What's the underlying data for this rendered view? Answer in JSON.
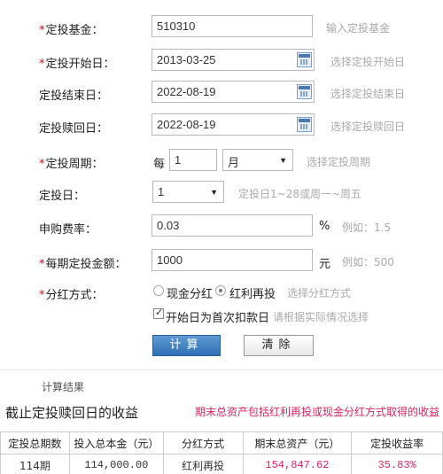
{
  "form": {
    "fund": {
      "label": "定投基金：",
      "required": true,
      "value": "510310",
      "hint": "输入定投基金"
    },
    "start": {
      "label": "定投开始日：",
      "required": true,
      "value": "2013-03-25",
      "hint": "选择定投开始日"
    },
    "end": {
      "label": "定投结束日：",
      "required": false,
      "value": "2022-08-19",
      "hint": "选择定投结束日"
    },
    "redeem": {
      "label": "定投赎回日：",
      "required": false,
      "value": "2022-08-19",
      "hint": "选择定投赎回日"
    },
    "period": {
      "label": "定投周期：",
      "required": true,
      "prefix": "每",
      "value": "1",
      "unit_select": "月",
      "hint": "选择定投周期"
    },
    "day": {
      "label": "定投日：",
      "required": false,
      "value": "1",
      "hint": "定投日1~28或周一~周五"
    },
    "fee": {
      "label": "申购费率：",
      "required": false,
      "value": "0.03",
      "unit": "%",
      "hint": "例如：1.5"
    },
    "amount": {
      "label": "每期定投金额：",
      "required": true,
      "value": "1000",
      "unit": "元",
      "hint": "例如：500"
    },
    "dividend": {
      "label": "分红方式：",
      "required": true,
      "option_cash": "现金分红",
      "option_reinvest": "红利再投",
      "selected": "红利再投",
      "hint": "选择分红方式"
    },
    "first_day": {
      "label": "开始日为首次扣款日",
      "checked": true,
      "hint": "请根据实际情况选择"
    }
  },
  "buttons": {
    "calc": "计算",
    "clear": "清除"
  },
  "result": {
    "section_title": "计算结果",
    "subtitle": "截止定投赎回日的收益",
    "note": "期末总资产包括红利再投或现金分红方式取得的收益",
    "columns": [
      "定投总期数",
      "投入总本金（元）",
      "分红方式",
      "期末总资产（元）",
      "定投收益率"
    ],
    "rows": [
      [
        "114期",
        "114,000.00",
        "红利再投",
        "154,847.62",
        "35.83%"
      ]
    ]
  },
  "colors": {
    "required_star": "#e60012",
    "accent_red": "#e0245e",
    "button_blue": "#2f6fb4"
  },
  "icons": {
    "calendar": "calendar-icon",
    "dropdown": "chevron-down-icon"
  }
}
